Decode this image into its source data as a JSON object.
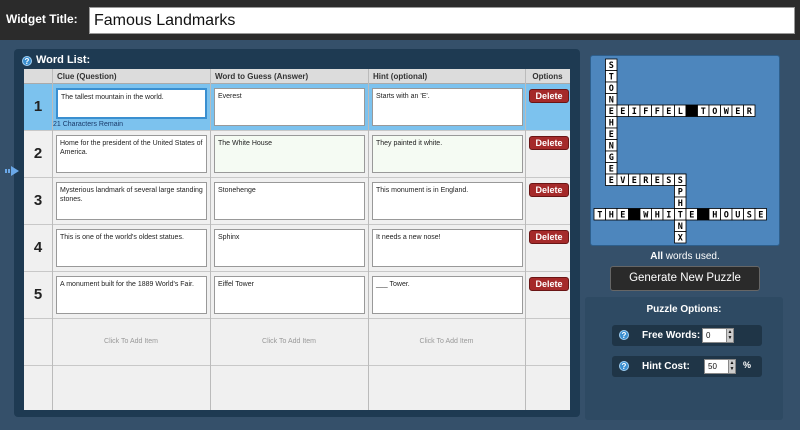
{
  "widget": {
    "title_label": "Widget Title:",
    "title_value": "Famous Landmarks"
  },
  "word_list": {
    "title": "Word List:",
    "columns": [
      "Clue (Question)",
      "Word to Guess (Answer)",
      "Hint (optional)",
      "Options"
    ],
    "rows": [
      {
        "num": "1",
        "clue": "The tallest mountain in the world.",
        "answer": "Everest",
        "hint": "Starts with an 'E'.",
        "delete": "Delete"
      },
      {
        "num": "2",
        "clue": "Home for the president of the United States of America.",
        "answer": "The White House",
        "hint": "They painted it white.",
        "delete": "Delete"
      },
      {
        "num": "3",
        "clue": "Mysterious landmark of several large standing stones.",
        "answer": "Stonehenge",
        "hint": "This monument is in England.",
        "delete": "Delete"
      },
      {
        "num": "4",
        "clue": "This is one of the world's oldest statues.",
        "answer": "Sphinx",
        "hint": "It needs a new nose!",
        "delete": "Delete"
      },
      {
        "num": "5",
        "clue": "A monument built for the 1889 World's Fair.",
        "answer": "Eiffel Tower",
        "hint": "___ Tower.",
        "delete": "Delete"
      }
    ],
    "chars_remaining": "21 Characters Remain",
    "add_item": "Click To Add Item"
  },
  "puzzle": {
    "all_words_bold": "All",
    "all_words_rest": " words used.",
    "generate_label": "Generate New Puzzle",
    "words": {
      "stonehenge": "STONEHENGE",
      "eiffel": "EIFFEL TOWER",
      "everest": "EVEREST",
      "sphinx": "SPHINX",
      "whitehouse": "THE WHITE HOUSE"
    }
  },
  "options": {
    "title": "Puzzle Options:",
    "free_words_label": "Free Words:",
    "free_words_value": "0",
    "hint_cost_label": "Hint Cost:",
    "hint_cost_value": "50",
    "hint_cost_unit": "%"
  },
  "colors": {
    "background": "#35506a",
    "selected_row": "#7cc2ee",
    "delete_button": "#a52a2a",
    "help_icon": "#3a8fd0"
  },
  "icons": {
    "help": "help-icon",
    "move_row": "arrow-right-icon",
    "stepper": "stepper-arrows-icon"
  }
}
